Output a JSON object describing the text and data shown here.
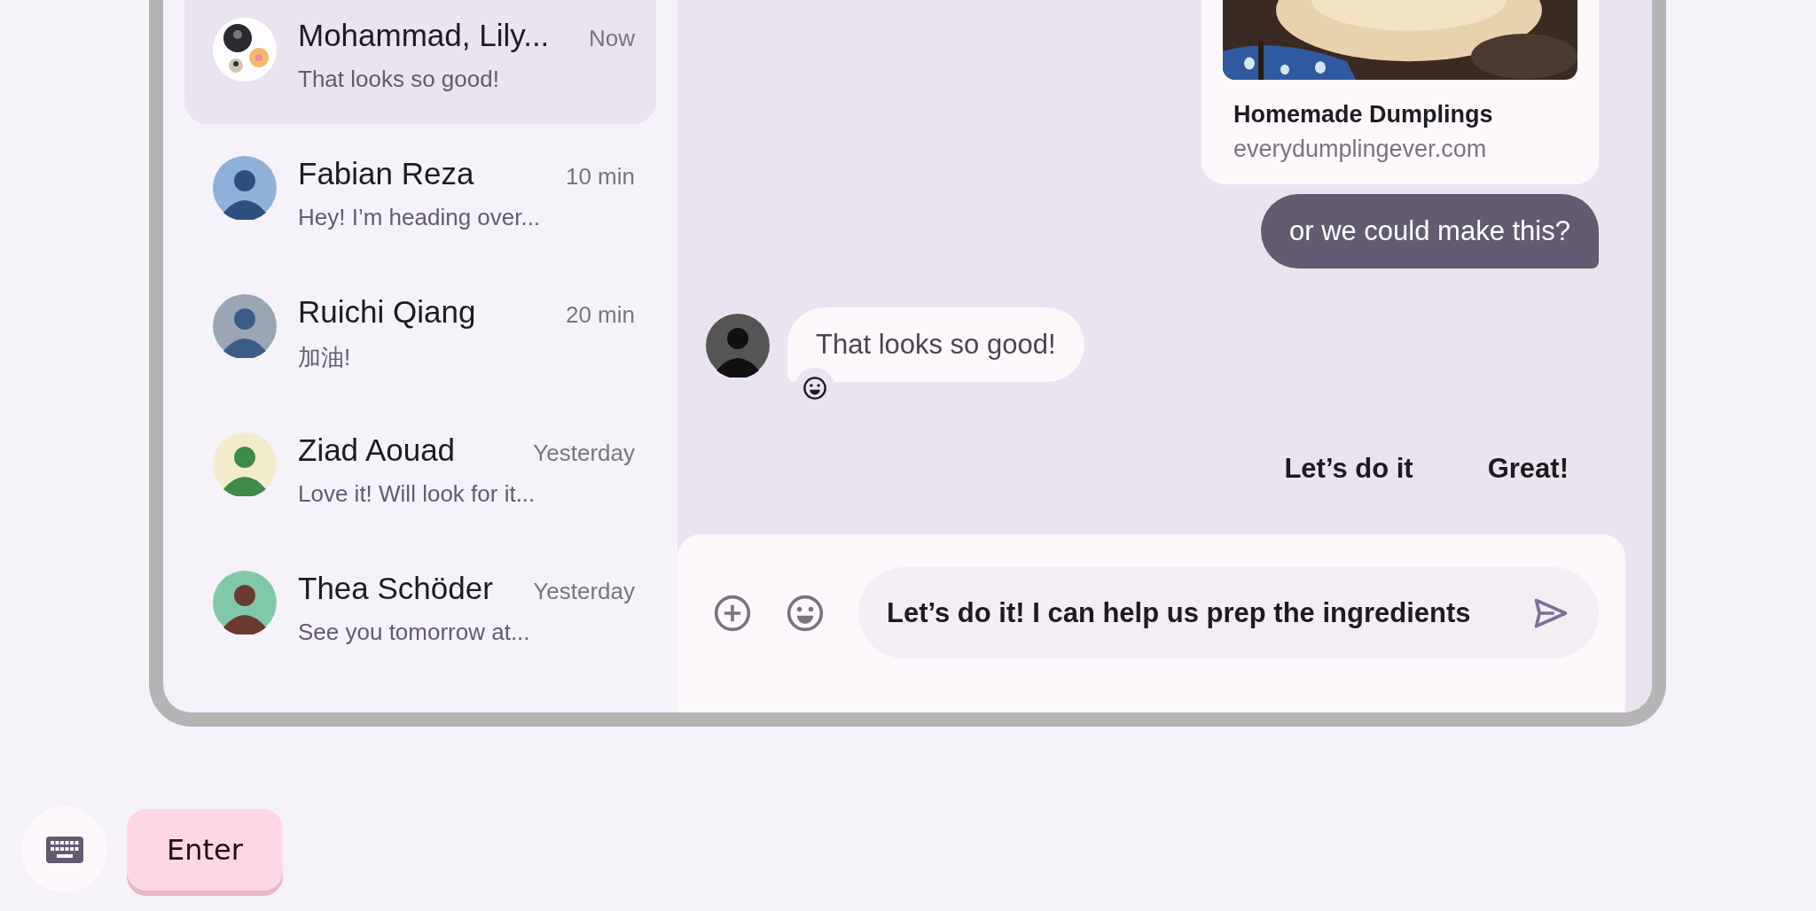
{
  "conversations": [
    {
      "kind": "group",
      "name": "Mohammad, Lily...",
      "time": "Now",
      "preview": "That looks so good!",
      "selected": true
    },
    {
      "kind": "person",
      "name": "Fabian Reza",
      "time": "10 min",
      "preview": "Hey! I’m heading over...",
      "selected": false
    },
    {
      "kind": "person",
      "name": "Ruichi Qiang",
      "time": "20 min",
      "preview": "加油!",
      "selected": false
    },
    {
      "kind": "person",
      "name": "Ziad Aouad",
      "time": "Yesterday",
      "preview": "Love it! Will look for it...",
      "selected": false
    },
    {
      "kind": "person",
      "name": "Thea Schöder",
      "time": "Yesterday",
      "preview": "See you tomorrow at...",
      "selected": false
    }
  ],
  "messages": [
    {
      "kind": "link",
      "title": "Homemade Dumplings",
      "url": "everydumplingever.com"
    },
    {
      "kind": "outgoing",
      "text": "or we could make this?"
    },
    {
      "kind": "incoming",
      "text": "That looks so good!",
      "reacted": true
    }
  ],
  "suggestions": [
    "Let’s do it",
    "Great!"
  ],
  "composer": {
    "value": "Let’s do it! I can help us prep the ingredients"
  },
  "keyboard": {
    "enter_label": "Enter"
  }
}
